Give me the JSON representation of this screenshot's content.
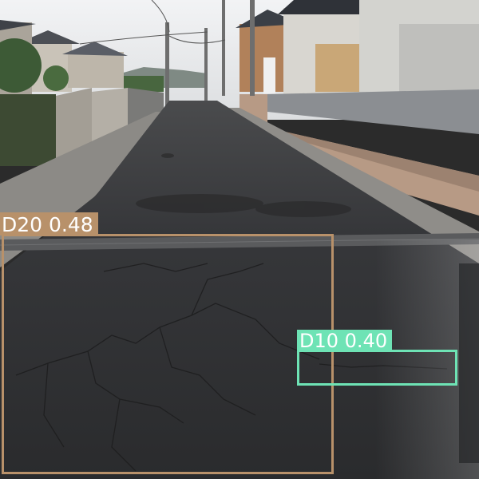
{
  "colors": {
    "sky": "#e9eaec",
    "asphalt": "#2f3031",
    "sidewalk": "#8c8a86",
    "wall_right": "#b79a85",
    "d20": "#b8916a",
    "d10": "#6ee3b5"
  },
  "detections": [
    {
      "id": "d20",
      "label": "D20 0.48",
      "color": "#b8916a"
    },
    {
      "id": "d10",
      "label": "D10 0.40",
      "color": "#6ee3b5"
    }
  ]
}
